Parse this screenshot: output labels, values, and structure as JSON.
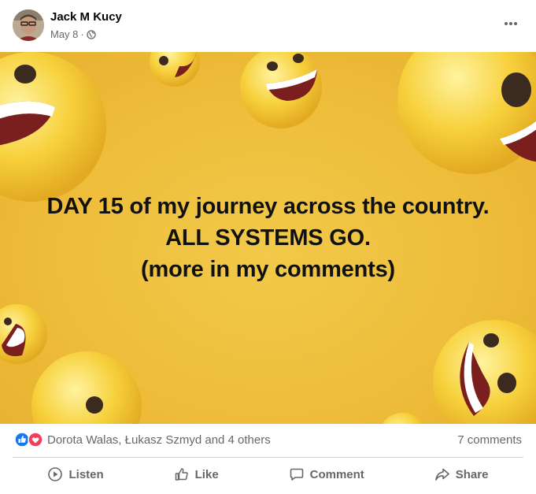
{
  "post": {
    "author": "Jack M Kucy",
    "date": "May 8",
    "separator": "·",
    "privacy_icon": "globe-icon",
    "menu_icon": "more-options-icon",
    "image_text": {
      "line1": "DAY 15 of my journey across the country.",
      "line2": "ALL SYSTEMS GO.",
      "line3": "(more in my comments)"
    },
    "image_background_color": "#eebd3a"
  },
  "reactions": {
    "icons": [
      "like-reaction-icon",
      "love-reaction-icon"
    ],
    "summary": "Dorota Walas, Łukasz Szmyd and 4 others",
    "comments": "7 comments",
    "like_color": "#1877f2",
    "love_color": "#f33e58"
  },
  "actions": {
    "listen": "Listen",
    "like": "Like",
    "comment": "Comment",
    "share": "Share"
  }
}
